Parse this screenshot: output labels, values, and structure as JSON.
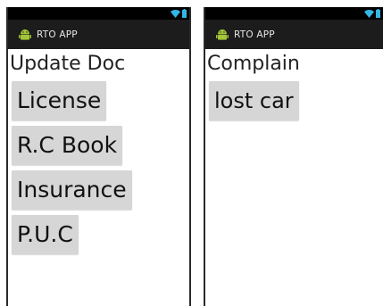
{
  "screens": [
    {
      "app_title": "RTO APP",
      "heading": "Update Doc",
      "buttons": [
        "License",
        "R.C Book",
        "Insurance",
        "P.U.C"
      ]
    },
    {
      "app_title": "RTO APP",
      "heading": "Complain",
      "buttons": [
        "lost car"
      ]
    }
  ],
  "icons": {
    "app": "android-icon",
    "status": [
      "wifi-icon",
      "battery-icon"
    ]
  },
  "colors": {
    "status_bar": "#000000",
    "action_bar": "#1c1c1c",
    "button_bg": "#d6d6d6",
    "android_green": "#a4c639",
    "status_icon": "#33b5e5"
  }
}
